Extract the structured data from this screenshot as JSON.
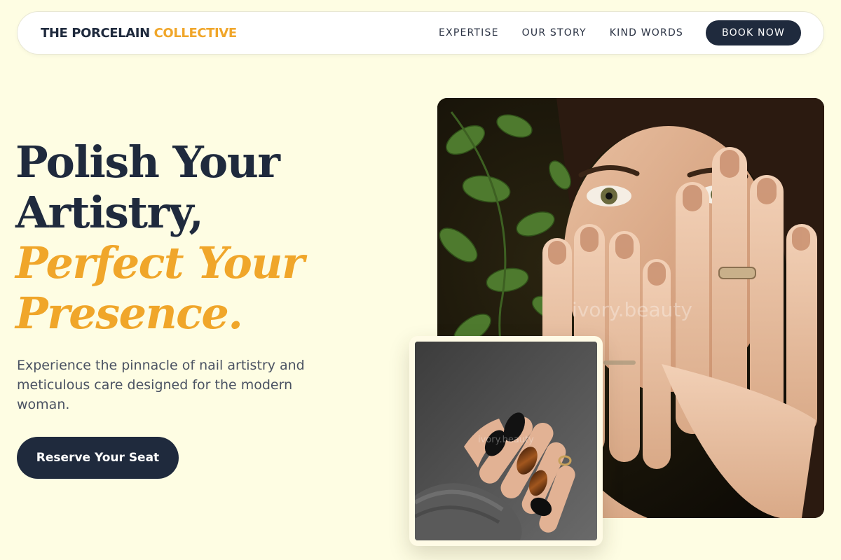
{
  "brand": {
    "part1": "THE PORCELAIN",
    "part2": "COLLECTIVE"
  },
  "nav": {
    "links": [
      "EXPERTISE",
      "OUR STORY",
      "KIND WORDS"
    ],
    "cta": "BOOK NOW"
  },
  "hero": {
    "line1": "Polish Your",
    "line2": "Artistry,",
    "line3": "Perfect Your",
    "line4": "Presence.",
    "subtext": "Experience the pinnacle of nail artistry and meticulous care designed for the modern woman.",
    "cta": "Reserve Your Seat"
  },
  "images": {
    "main_watermark": "ivory.beauty",
    "inset_watermark": "ivory.beauty"
  },
  "colors": {
    "background": "#fefde3",
    "navy": "#1f2a3d",
    "accent": "#f0a62a"
  }
}
